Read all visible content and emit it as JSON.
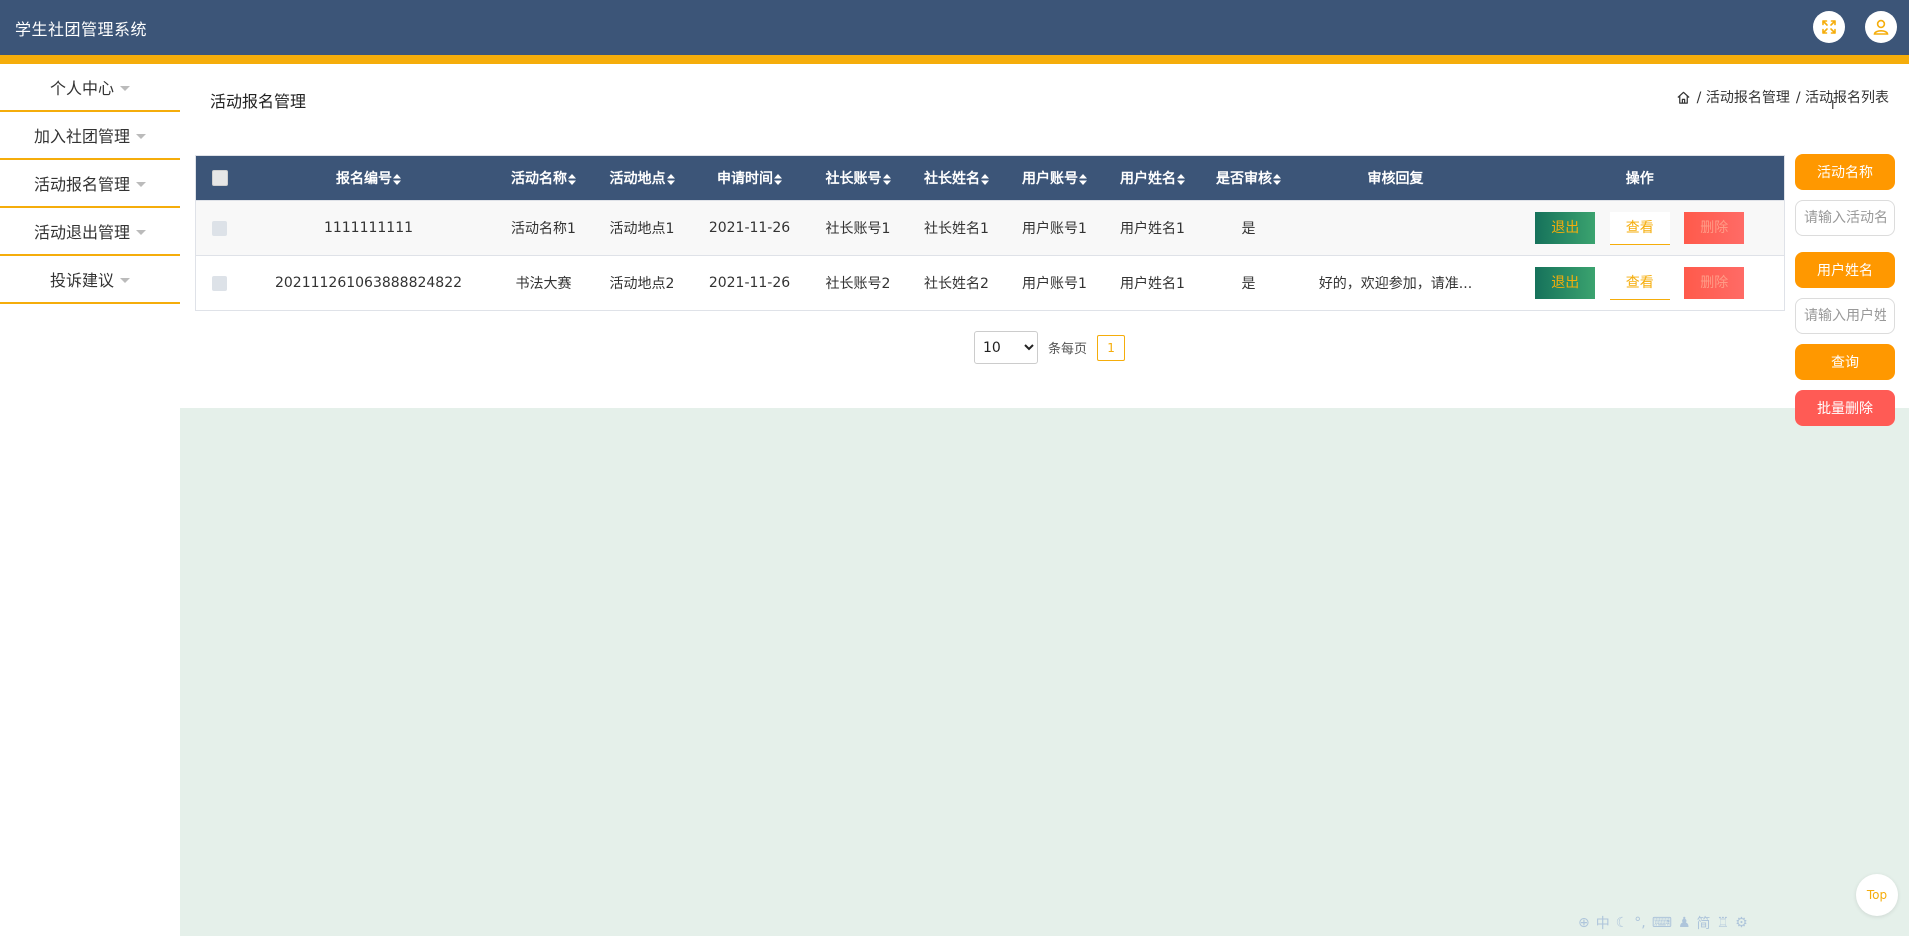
{
  "app": {
    "title": "学生社团管理系统"
  },
  "sidebar": {
    "items": [
      {
        "label": "个人中心"
      },
      {
        "label": "加入社团管理"
      },
      {
        "label": "活动报名管理"
      },
      {
        "label": "活动退出管理"
      },
      {
        "label": "投诉建议"
      }
    ]
  },
  "page": {
    "title": "活动报名管理",
    "breadcrumb": [
      "/ 活动报名管理",
      "/ 活动报名列表"
    ]
  },
  "table": {
    "headers": [
      "报名编号",
      "活动名称",
      "活动地点",
      "申请时间",
      "社长账号",
      "社长姓名",
      "用户账号",
      "用户姓名",
      "是否审核",
      "审核回复",
      "操作"
    ],
    "rows": [
      {
        "id": "1111111111",
        "name": "活动名称1",
        "place": "活动地点1",
        "date": "2021-11-26",
        "leader_account": "社长账号1",
        "leader_name": "社长姓名1",
        "user_account": "用户账号1",
        "user_name": "用户姓名1",
        "reviewed": "是",
        "reply": ""
      },
      {
        "id": "20211126106388882​4822",
        "name": "书法大赛",
        "place": "活动地点2",
        "date": "2021-11-26",
        "leader_account": "社长账号2",
        "leader_name": "社长姓名2",
        "user_account": "用户账号1",
        "user_name": "用户姓名1",
        "reviewed": "是",
        "reply": "好的，欢迎参加，请准..."
      }
    ],
    "actions": {
      "exit": "退出",
      "view": "查看",
      "delete": "删除"
    }
  },
  "pagination": {
    "page_size": "10",
    "per_page_label": "条每页",
    "current_page": "1"
  },
  "search": {
    "activity_label": "活动名称",
    "activity_placeholder": "请输入活动名称",
    "user_label": "用户姓名",
    "user_placeholder": "请输入用户姓名",
    "query_button": "查询",
    "batch_delete_button": "批量删除"
  },
  "floating": {
    "top": "Top"
  },
  "ime": {
    "chinese": "中",
    "simplified": "简"
  },
  "colors": {
    "header": "#3c5578",
    "accent": "#f5ad0b",
    "orange": "#ff9800",
    "danger": "#ff5b55",
    "content_bg": "#e5f0ea"
  }
}
